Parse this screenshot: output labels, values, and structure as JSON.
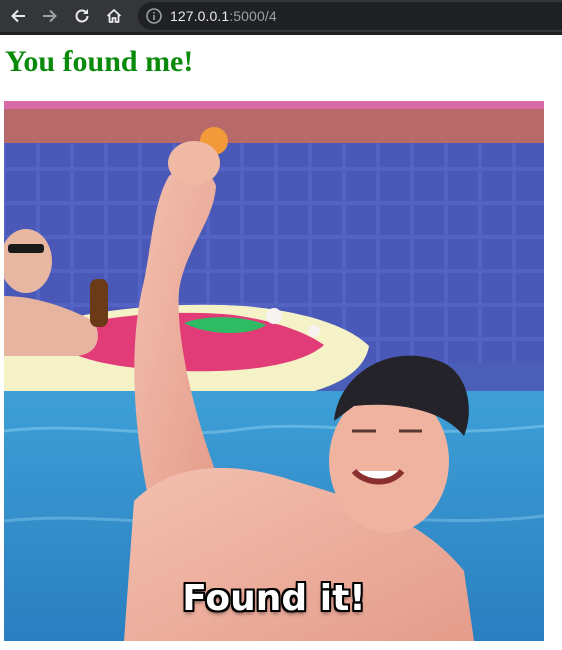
{
  "browser": {
    "url_host": "127.0.0.1",
    "url_path": ":5000/4",
    "icons": [
      "back-icon",
      "forward-icon",
      "reload-icon",
      "home-icon",
      "info-icon"
    ]
  },
  "page": {
    "heading": "You found me!",
    "heading_color": "#0a8a0a"
  },
  "gif": {
    "caption": "Found it!"
  }
}
